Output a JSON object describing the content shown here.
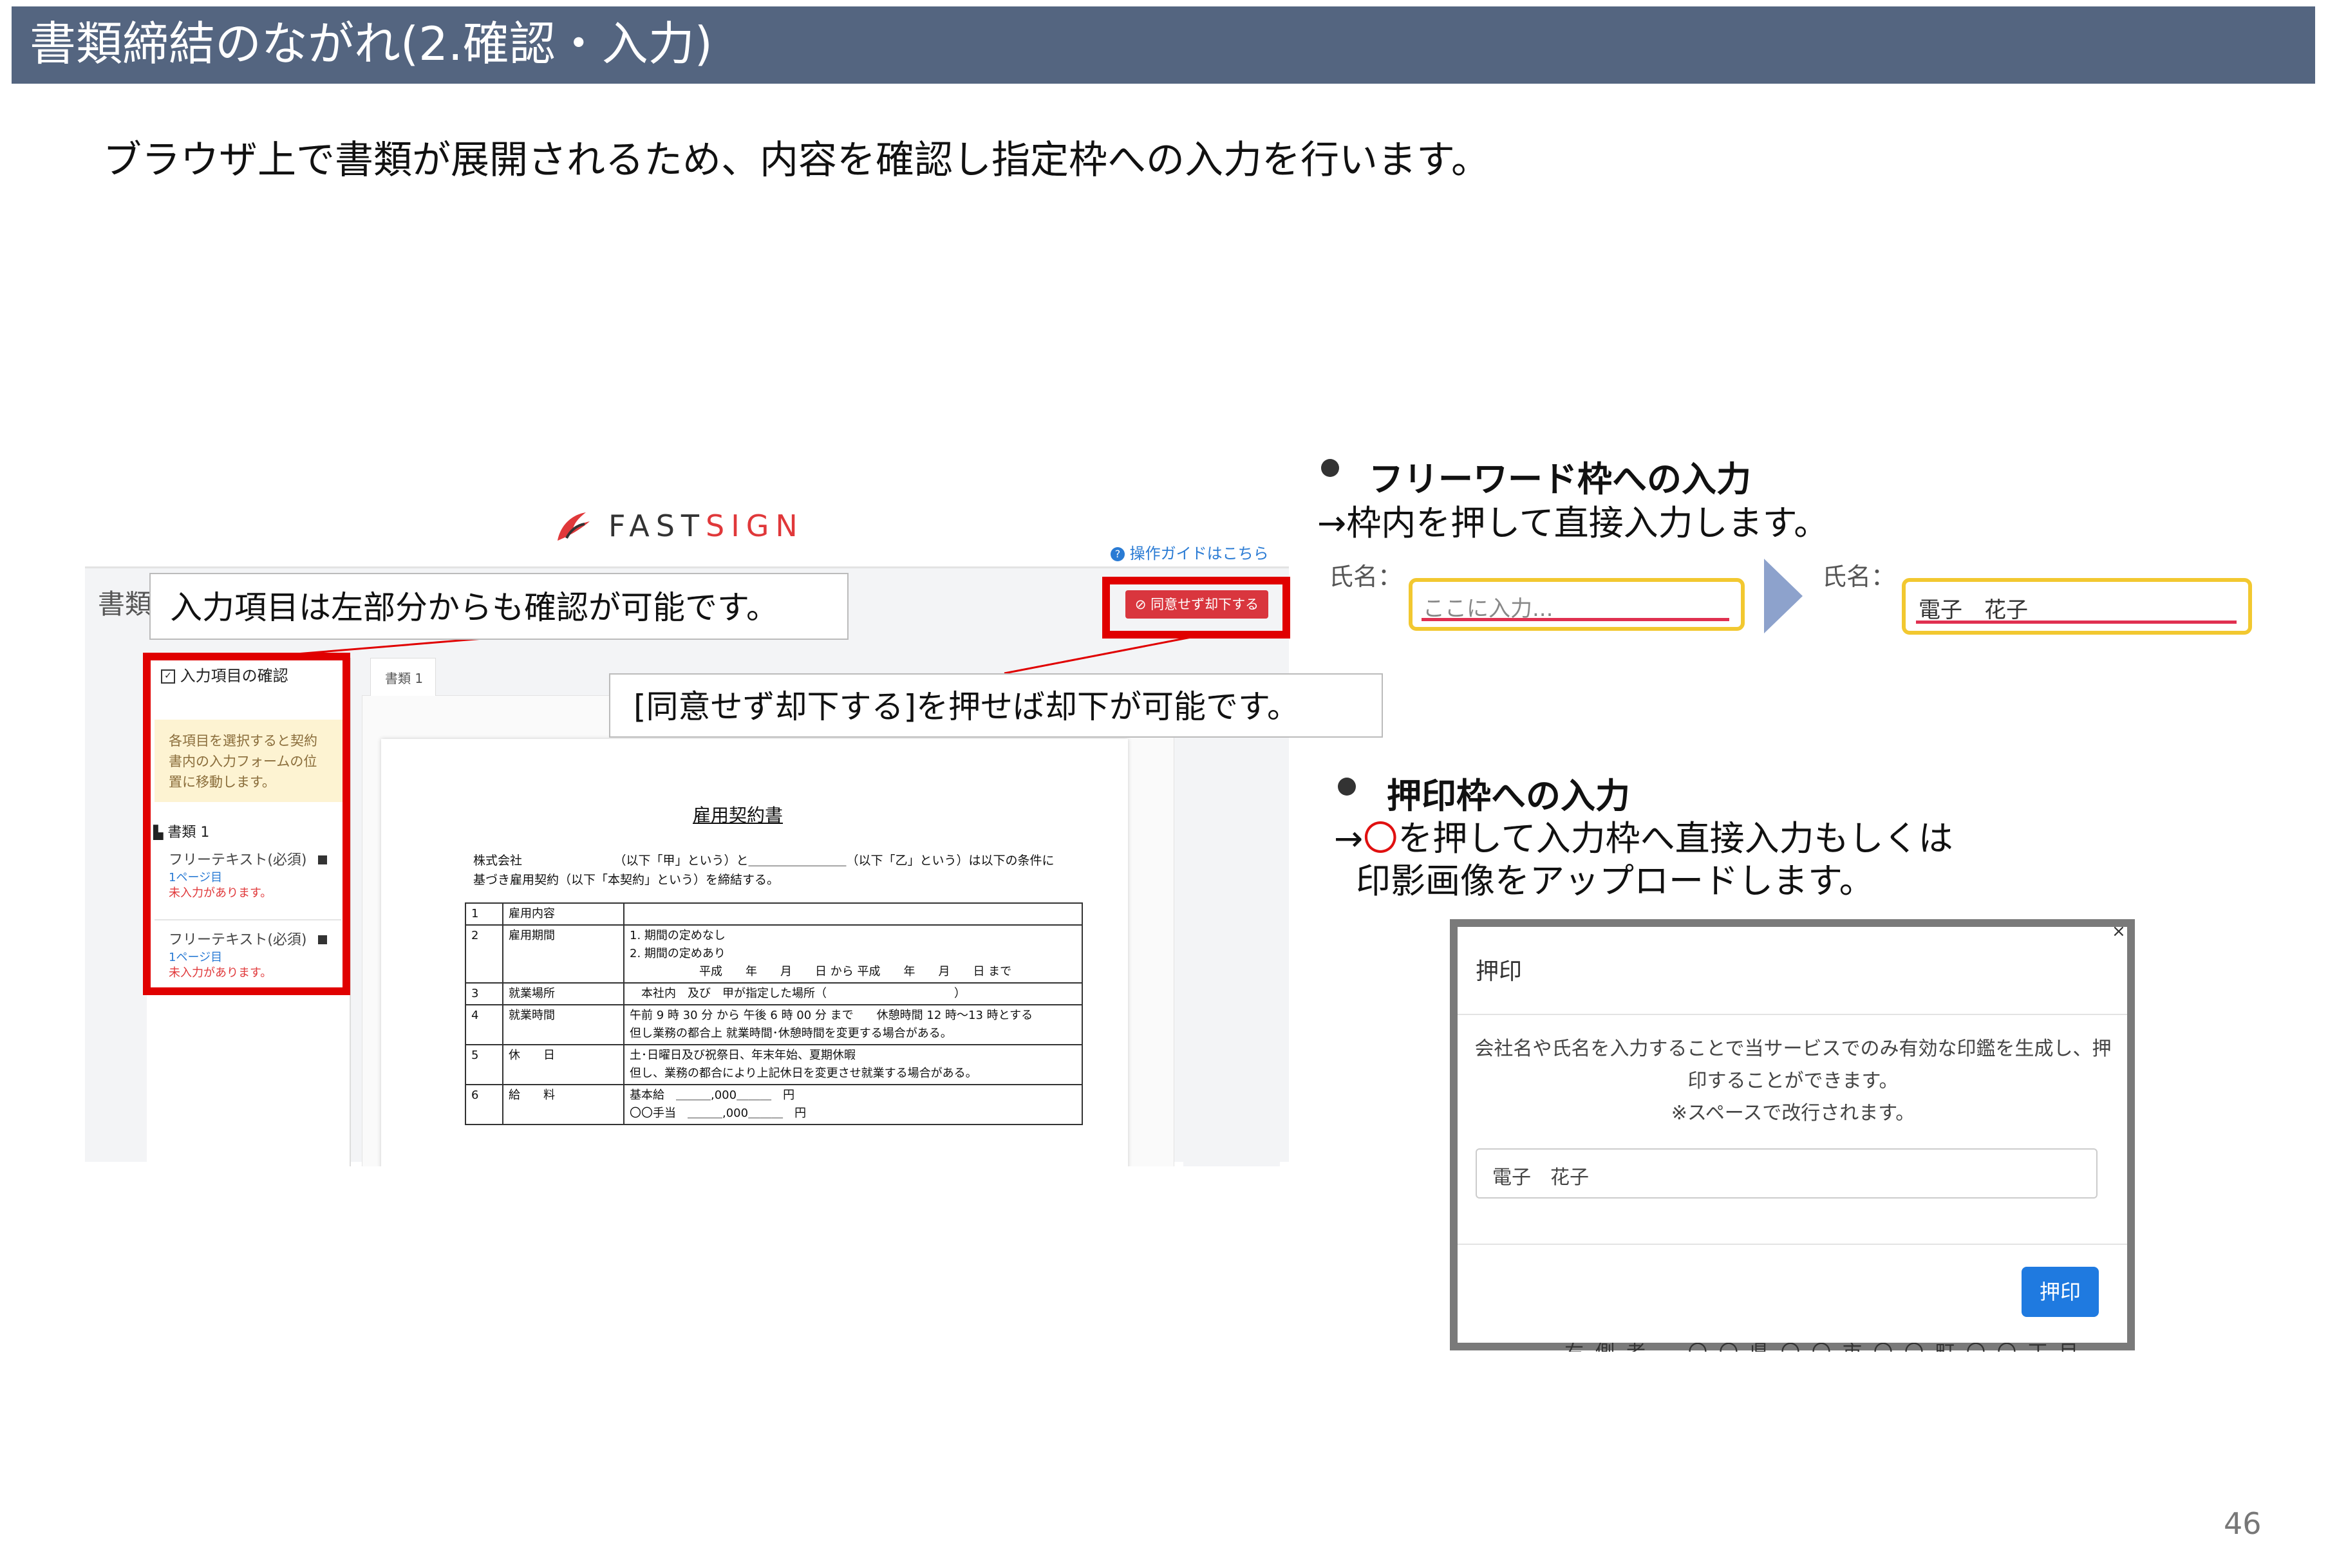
{
  "slide": {
    "title": "書類締結のながれ(2.確認・入力)",
    "subtitle": "ブラウザ上で書類が展開されるため、内容を確認し指定枠への入力を行います。",
    "page_number": "46"
  },
  "app": {
    "logo": {
      "fast": "FAST",
      "sign": "SIGN"
    },
    "guide_link": "操作ガイドはこちら",
    "doc_title_fragment": "書類",
    "reject_button": "同意せず却下する",
    "left_panel": {
      "header": "入力項目の確認",
      "note": "各項目を選択すると契約書内の入力フォームの位置に移動します。",
      "book": "書類 1",
      "items": [
        {
          "label": "フリーテキスト(必須)",
          "page": "1ページ目",
          "warning": "未入力があります。"
        },
        {
          "label": "フリーテキスト(必須)",
          "page": "1ページ目",
          "warning": "未入力があります。"
        }
      ]
    },
    "tab": "書類 1",
    "document": {
      "title": "雇用契約書",
      "line1": "株式会社　　　　　　　　（以下「甲」という）と＿＿＿＿＿＿＿＿（以下「乙」という）は以下の条件に",
      "line2": "基づき雇用契約（以下「本契約」という）を締結する。",
      "rows": [
        {
          "no": "1",
          "item": "雇用内容",
          "content": ""
        },
        {
          "no": "2",
          "item": "雇用期間",
          "content": "1. 期間の定めなし\n2. 期間の定めあり\n　　　　　　平成　　年　　月　　日 から 平成　　年　　月　　日 まで"
        },
        {
          "no": "3",
          "item": "就業場所",
          "content": "　本社内　及び　甲が指定した場所（　　　　　　　　　　　）"
        },
        {
          "no": "4",
          "item": "就業時間",
          "content": "午前 9 時 30 分 から 午後 6 時 00 分 まで　　休憩時間 12 時〜13 時とする\n但し業務の都合上 就業時間･休憩時間を変更する場合がある。"
        },
        {
          "no": "5",
          "item": "休　　日",
          "content": "土･日曜日及び祝祭日、年末年始、夏期休暇\n但し、業務の都合により上記休日を変更させ就業する場合がある。"
        },
        {
          "no": "6",
          "item": "給　　料",
          "content": "基本給　＿＿＿,000＿＿＿　円\n〇〇手当　＿＿＿,000＿＿＿　円"
        }
      ]
    }
  },
  "callouts": {
    "left_panel": "入力項目は左部分からも確認が可能です。",
    "reject": "[同意せず却下する]を押せば却下が可能です。"
  },
  "freeword": {
    "title": "フリーワード枠への入力",
    "desc": "→枠内を押して直接入力します。",
    "label": "氏名：",
    "placeholder": "ここに入力...",
    "filled_value": "電子　花子"
  },
  "stamp": {
    "title": "押印枠への入力",
    "desc1_prefix": "→",
    "circle": "〇",
    "desc1_suffix": "を押して入力枠へ直接入力もしくは",
    "desc2": "印影画像をアップロードします。"
  },
  "dialog": {
    "title": "押印",
    "close": "×",
    "body1": "会社名や氏名を入力することで当サービスでのみ有効な印鑑を生成し、押印することができます。",
    "body2": "※スペースで改行されます。",
    "input_value": "電子　花子",
    "button": "押印",
    "behind_text": "右側者　〇〇県〇〇市〇〇町〇〇丁目〇〇番"
  },
  "colors": {
    "header_bg": "#546580",
    "highlight_red": "#e00000",
    "input_border": "#f2c830",
    "underline": "#e03050",
    "arrow": "#8da2cc",
    "primary_button": "#1f7ae0",
    "reject_button": "#d9363e"
  }
}
